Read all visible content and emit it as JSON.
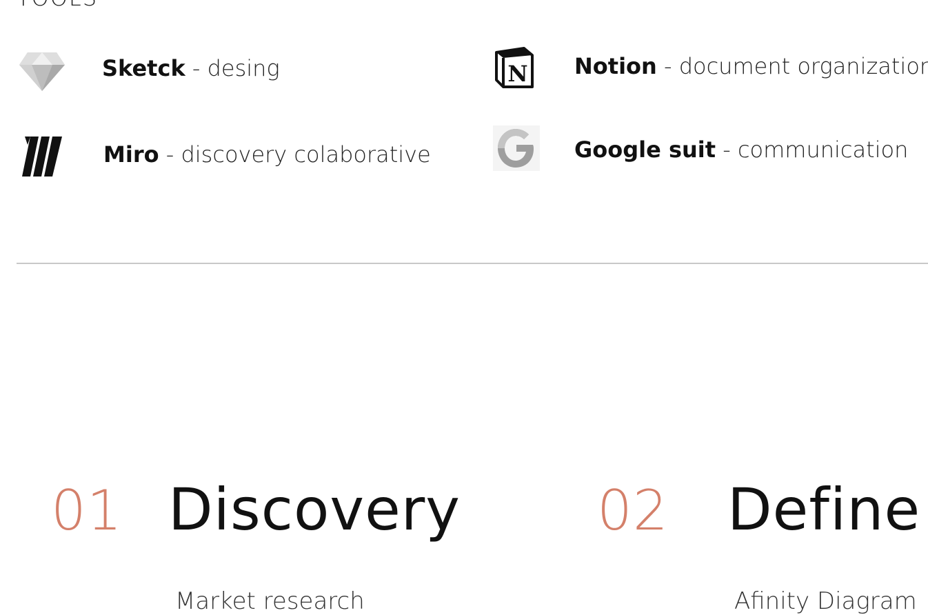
{
  "section": {
    "title": "TOOLS"
  },
  "tools": [
    {
      "name": "Sketck",
      "separator": " - ",
      "description": "desing",
      "icon": "sketch-diamond-icon"
    },
    {
      "name": "Notion",
      "separator": " - ",
      "description": "document organization",
      "icon": "notion-icon"
    },
    {
      "name": "Miro",
      "separator": " - ",
      "description": "discovery colaborative",
      "icon": "miro-icon"
    },
    {
      "name": "Google suit",
      "separator": " - ",
      "description": "communication",
      "icon": "google-g-icon"
    }
  ],
  "phases": [
    {
      "number": "01",
      "name": "Discovery",
      "first_item": "Market research"
    },
    {
      "number": "02",
      "name": "Define",
      "first_item": "Afinity Diagram"
    }
  ],
  "colors": {
    "accent": "#d4806a",
    "divider": "#c8c8c8",
    "text": "#111111"
  }
}
